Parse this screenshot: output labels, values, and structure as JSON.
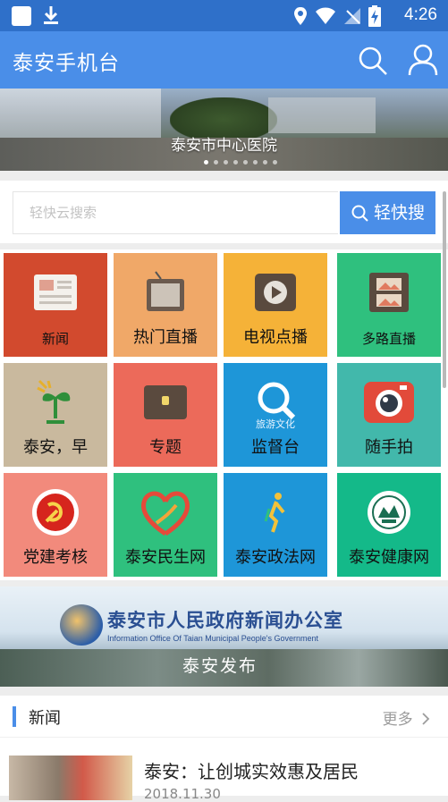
{
  "status_bar": {
    "time": "4:26"
  },
  "app_bar": {
    "title": "泰安手机台"
  },
  "banner": {
    "caption": "泰安市中心医院",
    "slide_count": 8,
    "active_slide": 1
  },
  "search": {
    "placeholder": "轻快云搜索",
    "button_label": "轻快搜"
  },
  "grid": {
    "tiles": [
      {
        "label": "新闻",
        "color": "#d24a2e",
        "icon": "newspaper-icon"
      },
      {
        "label": "热门直播",
        "color": "#f0a868",
        "icon": "tv-icon"
      },
      {
        "label": "电视点播",
        "color": "#f5b238",
        "icon": "play-icon"
      },
      {
        "label": "多路直播",
        "color": "#2fc07e",
        "icon": "film-icon"
      },
      {
        "label": "泰安，早",
        "color": "#c9b99e",
        "icon": "sprout-logo-icon"
      },
      {
        "label": "专题",
        "color": "#ec6a5a",
        "icon": "briefcase-icon"
      },
      {
        "label": "监督台",
        "color": "#1e96d8",
        "icon": "magnifier-icon",
        "sublabel": "旅游文化"
      },
      {
        "label": "随手拍",
        "color": "#42b8ab",
        "icon": "camera-icon"
      },
      {
        "label": "党建考核",
        "color": "#f28a7c",
        "icon": "party-emblem-icon"
      },
      {
        "label": "泰安民生网",
        "color": "#2fc07e",
        "icon": "heart-logo-icon"
      },
      {
        "label": "泰安政法网",
        "color": "#1e96d8",
        "icon": "figure-logo-icon"
      },
      {
        "label": "泰安健康网",
        "color": "#14b989",
        "icon": "seal-logo-icon"
      }
    ]
  },
  "ad": {
    "title": "泰安市人民政府新闻办公室",
    "subtitle": "Information Office Of Taian Municipal People's Government",
    "tagline": "泰安发布",
    "logo_text": "泰安发布"
  },
  "news": {
    "section_title": "新闻",
    "more_label": "更多",
    "items": [
      {
        "headline": "泰安：让创城实效惠及居民",
        "date": "2018.11.30"
      }
    ]
  }
}
